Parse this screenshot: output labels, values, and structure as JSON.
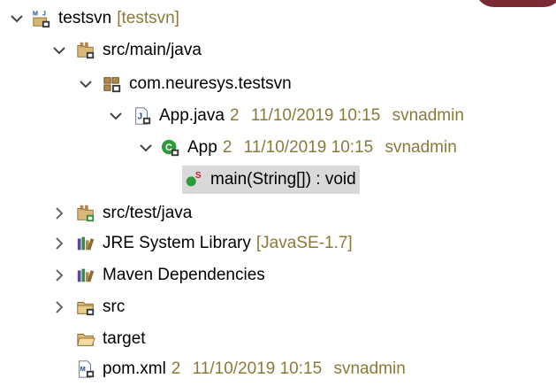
{
  "tree": {
    "project": {
      "label": "testsvn",
      "decoration": "[testsvn]"
    },
    "src_main": {
      "label": "src/main/java"
    },
    "package": {
      "label": "com.neuresys.testsvn"
    },
    "app_java": {
      "label": "App.java",
      "revision": "2",
      "date": "11/10/2019 10:15",
      "author": "svnadmin"
    },
    "app_class": {
      "label": "App",
      "revision": "2",
      "date": "11/10/2019 10:15",
      "author": "svnadmin"
    },
    "main_method": {
      "label": "main(String[]) : void"
    },
    "src_test": {
      "label": "src/test/java"
    },
    "jre": {
      "label": "JRE System Library",
      "decoration": "[JavaSE-1.7]"
    },
    "maven": {
      "label": "Maven Dependencies"
    },
    "src": {
      "label": "src"
    },
    "target": {
      "label": "target"
    },
    "pom": {
      "label": "pom.xml",
      "revision": "2",
      "date": "11/10/2019 10:15",
      "author": "svnadmin"
    }
  },
  "colors": {
    "decoration": "#8a7a3a",
    "selection": "#d9d9d9",
    "class_green": "#2f9a3a",
    "folder_tan": "#c9a868"
  }
}
